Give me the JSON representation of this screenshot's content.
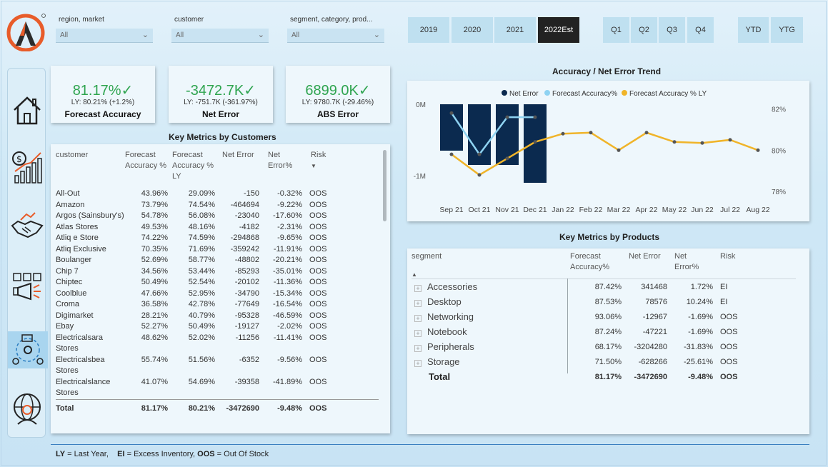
{
  "filters": [
    {
      "label": "region, market",
      "value": "All"
    },
    {
      "label": "customer",
      "value": "All"
    },
    {
      "label": "segment, category, prod...",
      "value": "All"
    }
  ],
  "years": [
    "2019",
    "2020",
    "2021",
    "2022Est"
  ],
  "quarters": [
    "Q1",
    "Q2",
    "Q3",
    "Q4"
  ],
  "periods": [
    "YTD",
    "YTG"
  ],
  "kpis": [
    {
      "value": "81.17%",
      "ly": "LY: 80.21% (+1.2%)",
      "title": "Forecast Accuracy"
    },
    {
      "value": "-3472.7K",
      "ly": "LY: -751.7K (-361.97%)",
      "title": "Net Error"
    },
    {
      "value": "6899.0K",
      "ly": "LY: 9780.7K (-29.46%)",
      "title": "ABS Error"
    }
  ],
  "customers": {
    "title": "Key Metrics by Customers",
    "headers": {
      "customer": "customer",
      "fa": "Forecast Accuracy %",
      "faly": "Forecast Accuracy % LY",
      "ne": "Net Error",
      "nep": "Net Error%",
      "risk": "Risk"
    },
    "rows": [
      [
        "All-Out",
        "43.96%",
        "29.09%",
        "-150",
        "-0.32%",
        "OOS"
      ],
      [
        "Amazon",
        "73.79%",
        "74.54%",
        "-464694",
        "-9.22%",
        "OOS"
      ],
      [
        "Argos (Sainsbury's)",
        "54.78%",
        "56.08%",
        "-23040",
        "-17.60%",
        "OOS"
      ],
      [
        "Atlas Stores",
        "49.53%",
        "48.16%",
        "-4182",
        "-2.31%",
        "OOS"
      ],
      [
        "Atliq e Store",
        "74.22%",
        "74.59%",
        "-294868",
        "-9.65%",
        "OOS"
      ],
      [
        "Atliq Exclusive",
        "70.35%",
        "71.69%",
        "-359242",
        "-11.91%",
        "OOS"
      ],
      [
        "Boulanger",
        "52.69%",
        "58.77%",
        "-48802",
        "-20.21%",
        "OOS"
      ],
      [
        "Chip 7",
        "34.56%",
        "53.44%",
        "-85293",
        "-35.01%",
        "OOS"
      ],
      [
        "Chiptec",
        "50.49%",
        "52.54%",
        "-20102",
        "-11.36%",
        "OOS"
      ],
      [
        "Coolblue",
        "47.66%",
        "52.95%",
        "-34790",
        "-15.34%",
        "OOS"
      ],
      [
        "Croma",
        "36.58%",
        "42.78%",
        "-77649",
        "-16.54%",
        "OOS"
      ],
      [
        "Digimarket",
        "28.21%",
        "40.79%",
        "-95328",
        "-46.59%",
        "OOS"
      ],
      [
        "Ebay",
        "52.27%",
        "50.49%",
        "-19127",
        "-2.02%",
        "OOS"
      ],
      [
        "Electricalsara Stores",
        "48.62%",
        "52.02%",
        "-11256",
        "-11.41%",
        "OOS"
      ],
      [
        "Electricalsbea Stores",
        "55.74%",
        "51.56%",
        "-6352",
        "-9.56%",
        "OOS"
      ],
      [
        "Electricalslance Stores",
        "41.07%",
        "54.69%",
        "-39358",
        "-41.89%",
        "OOS"
      ]
    ],
    "total": [
      "Total",
      "81.17%",
      "80.21%",
      "-3472690",
      "-9.48%",
      "OOS"
    ]
  },
  "chart_data": {
    "type": "bar+line",
    "title": "Accuracy / Net Error Trend",
    "categories": [
      "Sep 21",
      "Oct 21",
      "Nov 21",
      "Dec 21",
      "Jan 22",
      "Feb 22",
      "Mar 22",
      "Apr 22",
      "May 22",
      "Jun 22",
      "Jul 22",
      "Aug 22"
    ],
    "left_ticks": [
      "0M",
      "-1M"
    ],
    "right_ticks": [
      "82%",
      "80%",
      "78%"
    ],
    "series": [
      {
        "name": "Net Error",
        "type": "bar",
        "color": "#0b2a4f",
        "values": [
          -0.65,
          -0.85,
          -0.85,
          -1.1,
          null,
          null,
          null,
          null,
          null,
          null,
          null,
          null
        ]
      },
      {
        "name": "Forecast Accuracy%",
        "type": "line",
        "color": "#8fd3f2",
        "values": [
          81.8,
          79.8,
          81.6,
          81.6,
          null,
          null,
          null,
          null,
          null,
          null,
          null,
          null
        ]
      },
      {
        "name": "Forecast Accuracy % LY",
        "type": "line",
        "color": "#f0b429",
        "values": [
          79.8,
          78.8,
          79.6,
          80.4,
          80.8,
          80.85,
          80.0,
          80.85,
          80.4,
          80.35,
          80.5,
          80.0
        ]
      }
    ],
    "ylim_left": [
      -1.25,
      0.05
    ],
    "ylim_right": [
      77.9,
      82.4
    ]
  },
  "products": {
    "title": "Key Metrics by Products",
    "headers": {
      "segment": "segment",
      "fa": "Forecast Accuracy%",
      "ne": "Net Error",
      "nep": "Net Error%",
      "risk": "Risk"
    },
    "rows": [
      [
        "Accessories",
        "87.42%",
        "341468",
        "1.72%",
        "EI"
      ],
      [
        "Desktop",
        "87.53%",
        "78576",
        "10.24%",
        "EI"
      ],
      [
        "Networking",
        "93.06%",
        "-12967",
        "-1.69%",
        "OOS"
      ],
      [
        "Notebook",
        "87.24%",
        "-47221",
        "-1.69%",
        "OOS"
      ],
      [
        "Peripherals",
        "68.17%",
        "-3204280",
        "-31.83%",
        "OOS"
      ],
      [
        "Storage",
        "71.50%",
        "-628266",
        "-25.61%",
        "OOS"
      ]
    ],
    "total": [
      "Total",
      "81.17%",
      "-3472690",
      "-9.48%",
      "OOS"
    ]
  },
  "footer": {
    "ly_key": "LY",
    "ly_text": " = Last Year,",
    "ei_key": "EI",
    "ei_text": " = Excess Inventory, ",
    "oos_key": "OOS",
    "oos_text": " = Out Of Stock"
  },
  "nav": [
    "home-icon",
    "finance-icon",
    "partnership-icon",
    "marketing-icon",
    "supply-chain-icon",
    "global-executive-icon"
  ]
}
